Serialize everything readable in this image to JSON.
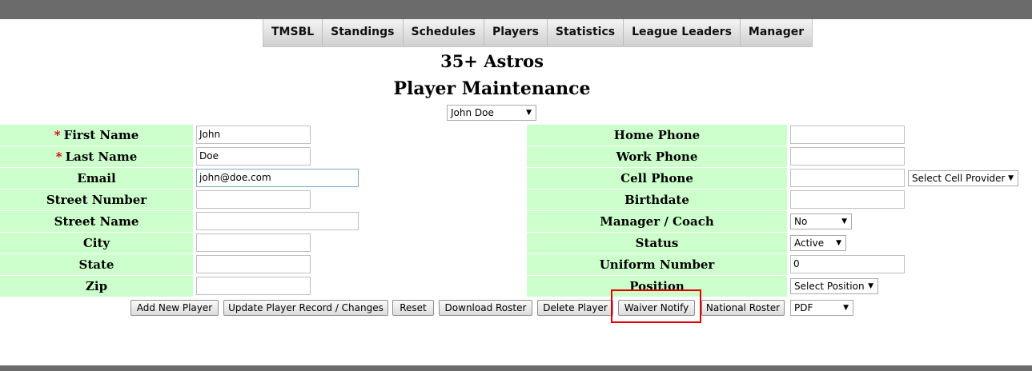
{
  "nav": [
    "TMSBL",
    "Standings",
    "Schedules",
    "Players",
    "Statistics",
    "League Leaders",
    "Manager"
  ],
  "page": {
    "team": "35+ Astros",
    "title": "Player Maintenance"
  },
  "player_select": "John Doe",
  "left_fields": [
    {
      "label": "First Name",
      "required": "*",
      "value": ""
    },
    {
      "label": "Last Name",
      "required": "*",
      "value": ""
    },
    {
      "label": "Email",
      "value": "john@doe.com"
    },
    {
      "label": "Street Number",
      "value": ""
    },
    {
      "label": "Street Name",
      "value": ""
    },
    {
      "label": "City",
      "value": ""
    },
    {
      "label": "State",
      "value": ""
    },
    {
      "label": "Zip",
      "value": ""
    }
  ],
  "first_name_value": "John",
  "last_name_value": "Doe",
  "right_fields": [
    {
      "label": "Home Phone",
      "value": ""
    },
    {
      "label": "Work Phone",
      "value": ""
    },
    {
      "label": "Cell Phone",
      "value": ""
    },
    {
      "label": "Birthdate",
      "value": ""
    },
    {
      "label": "Manager / Coach",
      "value": "No"
    },
    {
      "label": "Status",
      "value": "Active"
    },
    {
      "label": "Uniform Number",
      "value": "0"
    },
    {
      "label": "Position",
      "value": "Select Position"
    }
  ],
  "cell_provider": "Select Cell Provider",
  "buttons": {
    "add": "Add New Player",
    "update": "Update Player Record / Changes",
    "reset": "Reset",
    "download": "Download Roster",
    "delete": "Delete Player",
    "waiver": "Waiver Notify",
    "national": "National Roster"
  },
  "format_select": "PDF",
  "colors": {
    "label_bg": "#ccffcc",
    "required": "#d40000",
    "highlight": "#e00000",
    "bar": "#6b6b6b"
  }
}
